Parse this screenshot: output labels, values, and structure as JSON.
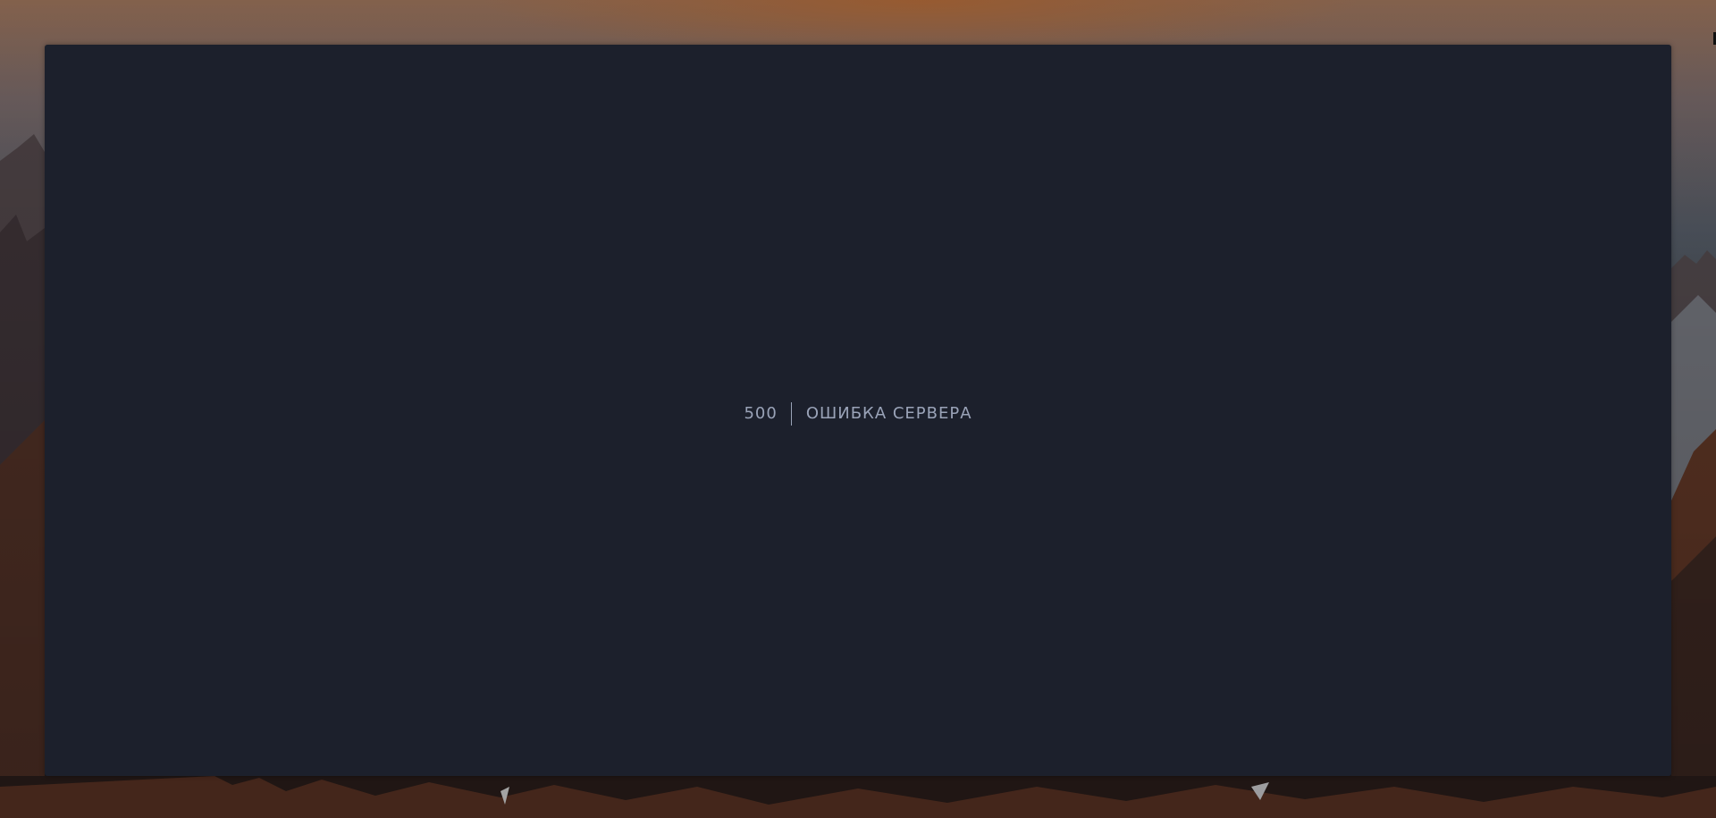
{
  "error": {
    "code": "500",
    "message": "ОШИБКА СЕРВЕРА"
  },
  "colors": {
    "panel_background": "#1c202c",
    "text": "#9aa3b8",
    "wallpaper_glow": "#a05f32"
  },
  "icons": {
    "background": "mountain-landscape-image"
  }
}
